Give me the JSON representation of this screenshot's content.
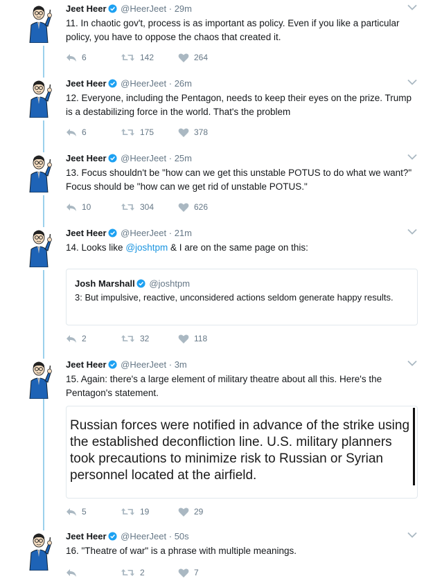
{
  "colors": {
    "link": "#1b95e0",
    "thread_line": "#9bd0ec",
    "meta": "#657786",
    "verified": "#1da1f2"
  },
  "tweets": [
    {
      "name": "Jeet Heer",
      "handle": "@HeerJeet",
      "time": "· 29m",
      "text": "11. In chaotic gov't, process is as important as policy. Even if you like a particular policy, you have to oppose the chaos that created it.",
      "replies": "6",
      "retweets": "142",
      "likes": "264"
    },
    {
      "name": "Jeet Heer",
      "handle": "@HeerJeet",
      "time": "· 26m",
      "text": "12. Everyone, including the Pentagon, needs to keep their eyes on the prize. Trump is a destabilizing force in the world. That's the problem",
      "replies": "6",
      "retweets": "175",
      "likes": "378"
    },
    {
      "name": "Jeet Heer",
      "handle": "@HeerJeet",
      "time": "· 25m",
      "text": "13. Focus shouldn't be \"how can we get this unstable POTUS to do what we want?\" Focus should be \"how can we get rid of unstable POTUS.\"",
      "replies": "10",
      "retweets": "304",
      "likes": "626"
    },
    {
      "name": "Jeet Heer",
      "handle": "@HeerJeet",
      "time": "· 21m",
      "text_before": "14. Looks like ",
      "mention": "@joshtpm",
      "text_after": " & I are on the same page on this:",
      "quote": {
        "name": "Josh Marshall",
        "handle": "@joshtpm",
        "text": "3: But impulsive, reactive, unconsidered actions seldom generate happy results."
      },
      "replies": "2",
      "retweets": "32",
      "likes": "118"
    },
    {
      "name": "Jeet Heer",
      "handle": "@HeerJeet",
      "time": "· 3m",
      "text": "15. Again: there's a large element of military theatre about all this. Here's the Pentagon's statement.",
      "media_text": "Russian forces were notified in advance of the strike using the established deconfliction line.  U.S. military planners took precautions to minimize risk to Russian or Syrian personnel located at the airfield.",
      "replies": "5",
      "retweets": "19",
      "likes": "29"
    },
    {
      "name": "Jeet Heer",
      "handle": "@HeerJeet",
      "time": "· 50s",
      "text": "16. \"Theatre of war\" is a phrase with multiple meanings.",
      "replies": "",
      "retweets": "2",
      "likes": "7"
    }
  ]
}
